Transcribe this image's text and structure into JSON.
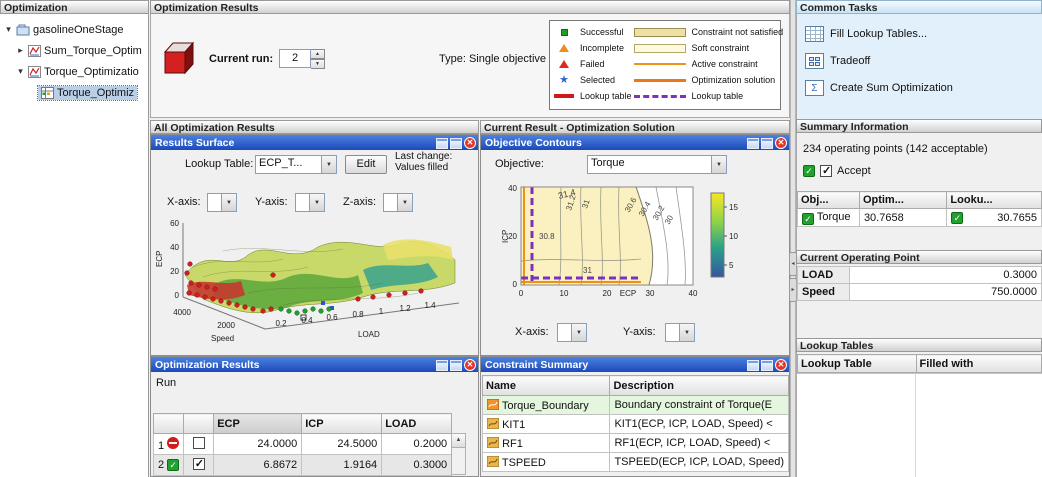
{
  "left_panel": {
    "title": "Optimization",
    "tree": [
      {
        "label": "gasolineOneStage"
      },
      {
        "label": "Sum_Torque_Optim"
      },
      {
        "label": "Torque_Optimizatio"
      },
      {
        "label": "Torque_Optimiz"
      }
    ]
  },
  "top": {
    "title": "Optimization Results",
    "current_run_label": "Current run:",
    "current_run_value": "2",
    "type_text": "Type: Single objective",
    "legend": {
      "successful": "Successful",
      "incomplete": "Incomplete",
      "failed": "Failed",
      "selected": "Selected",
      "lookup_table": "Lookup table",
      "constraint_not_satisfied": "Constraint not satisfied",
      "soft_constraint": "Soft constraint",
      "active_constraint": "Active constraint",
      "optimization_solution": "Optimization solution",
      "lookup_table2": "Lookup table"
    }
  },
  "sections": {
    "all_results": "All Optimization Results",
    "current_result": "Current Result - Optimization Solution"
  },
  "results_surface": {
    "panel_title": "Results Surface",
    "lookup_table_label": "Lookup Table:",
    "lookup_table_value": "ECP_T...",
    "edit_button": "Edit",
    "last_change_line1": "Last change:",
    "last_change_line2": "Values filled",
    "x_axis_label": "X-axis:",
    "y_axis_label": "Y-axis:",
    "z_axis_label": "Z-axis:",
    "plot": {
      "z_label": "ECP",
      "z_ticks": [
        "60",
        "40",
        "20",
        "0"
      ],
      "x_label": "Speed",
      "x_ticks": [
        "4000",
        "2000"
      ],
      "y_label": "LOAD",
      "y_ticks": [
        "0.2",
        "0.4",
        "0.6",
        "0.8",
        "1",
        "1.2",
        "1.4"
      ]
    }
  },
  "results_table": {
    "panel_title": "Optimization Results",
    "run_label": "Run",
    "col_ecp": "ECP",
    "col_icp": "ICP",
    "col_load": "LOAD",
    "rows": [
      {
        "num": "1",
        "ecp": "24.0000",
        "icp": "24.5000",
        "load": "0.2000"
      },
      {
        "num": "2",
        "ecp": "6.8672",
        "icp": "1.9164",
        "load": "0.3000"
      }
    ]
  },
  "objective_contours": {
    "panel_title": "Objective Contours",
    "objective_label": "Objective:",
    "objective_value": "Torque",
    "x_axis_label": "X-axis:",
    "y_axis_label": "Y-axis:",
    "plot": {
      "ylabel": "ICP",
      "y_ticks": [
        "40",
        "20",
        "0"
      ],
      "xlabel": "ECP",
      "x_ticks": [
        "0",
        "10",
        "20",
        "30",
        "40"
      ],
      "colorbar_ticks": [
        "15",
        "10",
        "5"
      ],
      "contour_labels": [
        "31.4",
        "31.2",
        "31",
        "30.8",
        "30.6",
        "30.4",
        "30.2",
        "30",
        "31"
      ]
    }
  },
  "constraint_summary": {
    "panel_title": "Constraint Summary",
    "col_name": "Name",
    "col_description": "Description",
    "rows": [
      {
        "name": "Torque_Boundary",
        "description": "Boundary constraint of Torque(E"
      },
      {
        "name": "KIT1",
        "description": "KIT1(ECP, ICP, LOAD, Speed) <"
      },
      {
        "name": "RF1",
        "description": "RF1(ECP, ICP, LOAD, Speed) <"
      },
      {
        "name": "TSPEED",
        "description": "TSPEED(ECP, ICP, LOAD, Speed)"
      }
    ]
  },
  "common_tasks": {
    "title": "Common Tasks",
    "items": [
      {
        "label": "Fill Lookup Tables..."
      },
      {
        "label": "Tradeoff"
      },
      {
        "label": "Create Sum Optimization"
      }
    ]
  },
  "summary_info": {
    "title": "Summary Information",
    "points_text": "234 operating points (142 acceptable)",
    "accept_label": "Accept",
    "col_objective": "Obj...",
    "col_optimized": "Optim...",
    "col_lookup": "Looku...",
    "row": {
      "objective": "Torque",
      "optimized": "30.7658",
      "lookup": "30.7655"
    }
  },
  "operating_point": {
    "title": "Current Operating Point",
    "rows": [
      {
        "label": "LOAD",
        "value": "0.3000"
      },
      {
        "label": "Speed",
        "value": "750.0000"
      }
    ]
  },
  "lookup_tables": {
    "title": "Lookup Tables",
    "col_table": "Lookup Table",
    "col_filled": "Filled with"
  }
}
